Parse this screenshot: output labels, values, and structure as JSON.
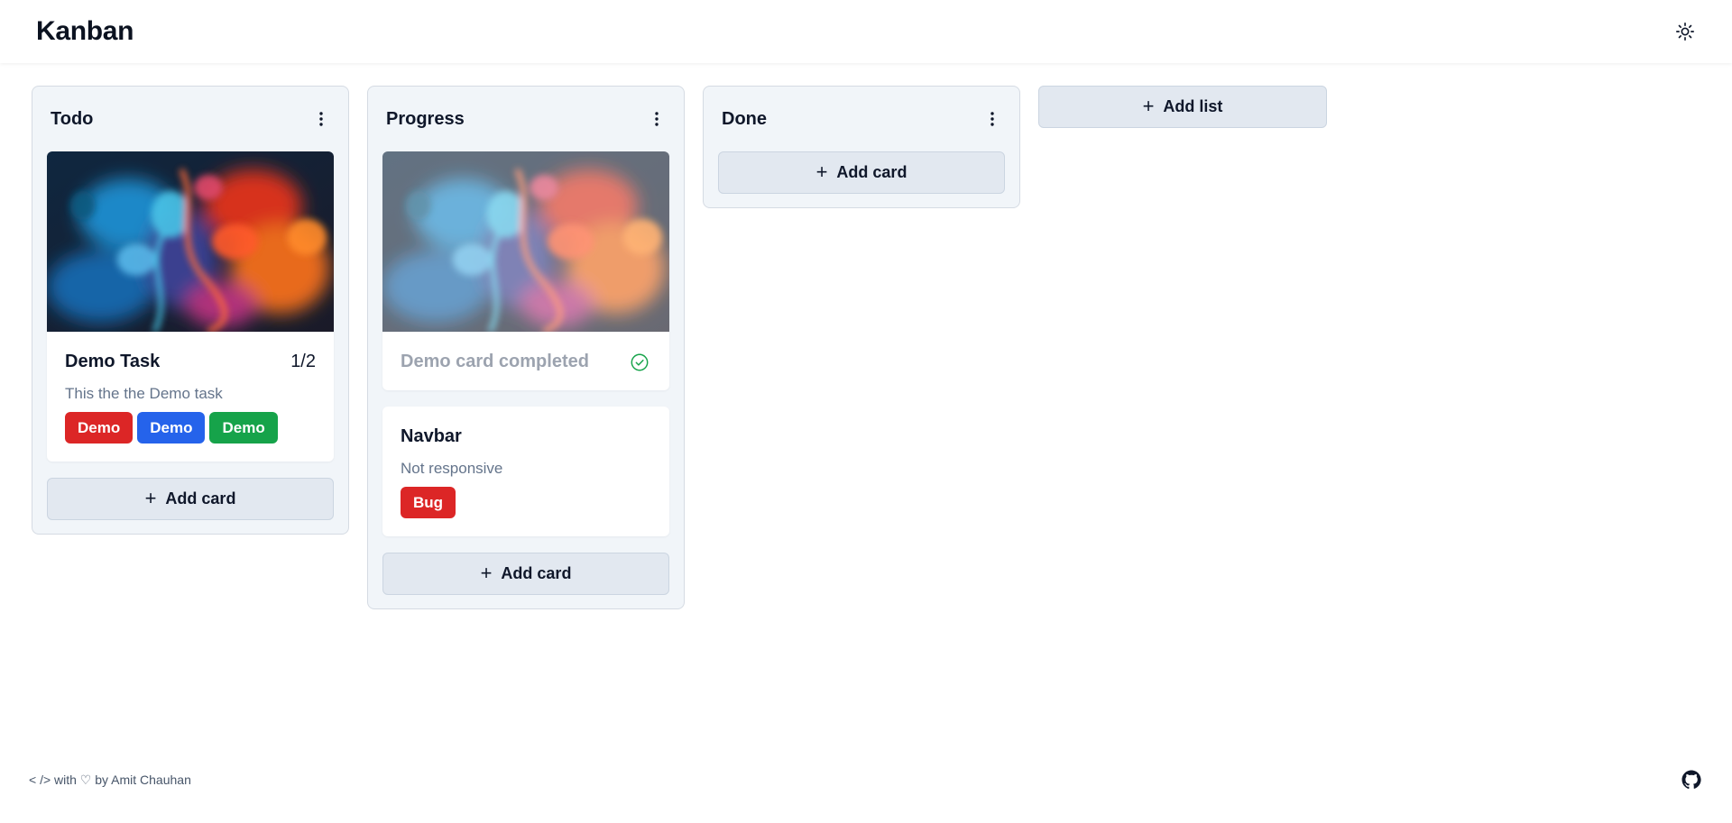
{
  "header": {
    "title": "Kanban",
    "theme_icon": "sun-icon"
  },
  "board": {
    "lists": [
      {
        "title": "Todo",
        "menu_icon": "vertical-dots-icon",
        "cards": [
          {
            "title": "Demo Task",
            "count": "1/2",
            "description": "This the the Demo task",
            "tags": [
              {
                "label": "Demo",
                "color": "#dc2626"
              },
              {
                "label": "Demo",
                "color": "#2563eb"
              },
              {
                "label": "Demo",
                "color": "#16a34a"
              }
            ]
          }
        ],
        "add_card_label": "Add card"
      },
      {
        "title": "Progress",
        "menu_icon": "vertical-dots-icon",
        "cards": [
          {
            "title": "Demo card completed",
            "completed": true,
            "status_icon": "check-circle-icon"
          },
          {
            "title": "Navbar",
            "description": "Not responsive",
            "tags": [
              {
                "label": "Bug",
                "color": "#dc2626"
              }
            ]
          }
        ],
        "add_card_label": "Add card"
      },
      {
        "title": "Done",
        "menu_icon": "vertical-dots-icon",
        "cards": [],
        "add_card_label": "Add card"
      }
    ],
    "add_list_label": "Add list"
  },
  "footer": {
    "credit": "< /> with ♡ by Amit Chauhan",
    "github_icon": "github-icon"
  },
  "colors": {
    "list_bg": "#f1f5f9",
    "button_bg": "#e2e8f0",
    "check": "#16a34a"
  }
}
